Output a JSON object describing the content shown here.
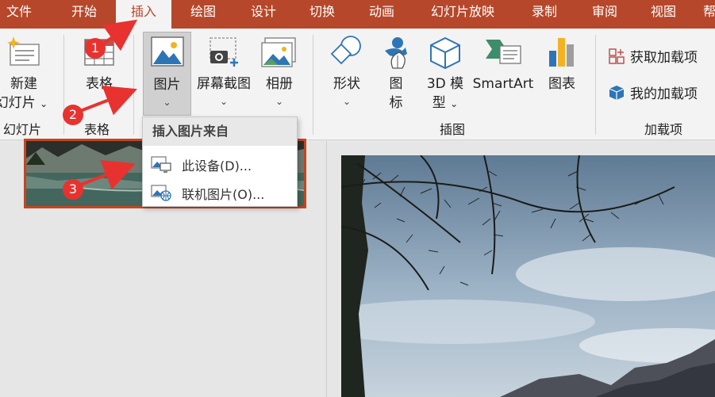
{
  "tabs": [
    {
      "label": "文件",
      "active": false
    },
    {
      "label": "开始",
      "active": false
    },
    {
      "label": "插入",
      "active": true
    },
    {
      "label": "绘图",
      "active": false
    },
    {
      "label": "设计",
      "active": false
    },
    {
      "label": "切换",
      "active": false
    },
    {
      "label": "动画",
      "active": false
    },
    {
      "label": "幻灯片放映",
      "active": false
    },
    {
      "label": "录制",
      "active": false
    },
    {
      "label": "审阅",
      "active": false
    },
    {
      "label": "视图",
      "active": false
    },
    {
      "label": "帮",
      "active": false
    }
  ],
  "ribbon": {
    "new_slide": {
      "line1": "新建",
      "line2": "幻灯片"
    },
    "table": {
      "label": "表格"
    },
    "picture": {
      "label": "图片"
    },
    "screenshot": {
      "label": "屏幕截图"
    },
    "album": {
      "label": "相册"
    },
    "shapes": {
      "label": "形状"
    },
    "icons": {
      "line1": "图",
      "line2": "标"
    },
    "model3d": {
      "line1": "3D 模",
      "line2": "型"
    },
    "smartart": {
      "label": "SmartArt"
    },
    "chart": {
      "label": "图表"
    },
    "get_addins": {
      "label": "获取加载项"
    },
    "my_addins": {
      "label": "我的加载项"
    },
    "groups": {
      "slides": "幻灯片",
      "tables": "表格",
      "illustrations": "插图",
      "addins": "加载项"
    },
    "chevron": "⌄"
  },
  "dropdown": {
    "header": "插入图片来自",
    "items": [
      {
        "label": "此设备(D)..."
      },
      {
        "label": "联机图片(O)..."
      }
    ]
  },
  "annotations": [
    "1",
    "2",
    "3"
  ],
  "colors": {
    "accent": "#b7472a",
    "arrow": "#e8322f"
  }
}
